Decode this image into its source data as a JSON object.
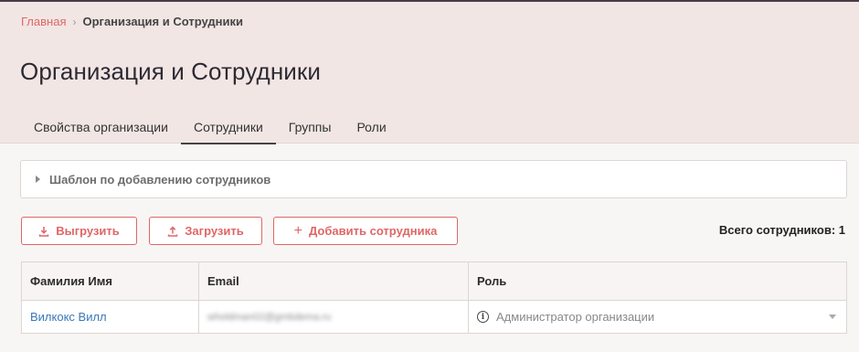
{
  "breadcrumb": {
    "home": "Главная",
    "separator": "›",
    "current": "Организация и Сотрудники"
  },
  "page": {
    "title": "Организация и Сотрудники"
  },
  "tabs": [
    {
      "label": "Свойства организации",
      "active": false
    },
    {
      "label": "Сотрудники",
      "active": true
    },
    {
      "label": "Группы",
      "active": false
    },
    {
      "label": "Роли",
      "active": false
    }
  ],
  "template_panel": {
    "label": "Шаблон по добавлению сотрудников",
    "expanded": false
  },
  "toolbar": {
    "export_label": "Выгрузить",
    "import_label": "Загрузить",
    "add_label": "Добавить сотрудника",
    "plus_glyph": "+",
    "total_label": "Всего сотрудников: 1"
  },
  "table": {
    "columns": [
      "Фамилия Имя",
      "Email",
      "Роль"
    ],
    "rows": [
      {
        "name": "Вилкокс Вилл",
        "email": "wholdman02@gmbdema.ru",
        "role": "Администратор организации"
      }
    ]
  },
  "icons": {
    "info": "i"
  },
  "colors": {
    "accent": "#e06666",
    "link": "#3a78b8",
    "header_bg": "#f1e6e4",
    "page_bg": "#f8f6f5"
  }
}
